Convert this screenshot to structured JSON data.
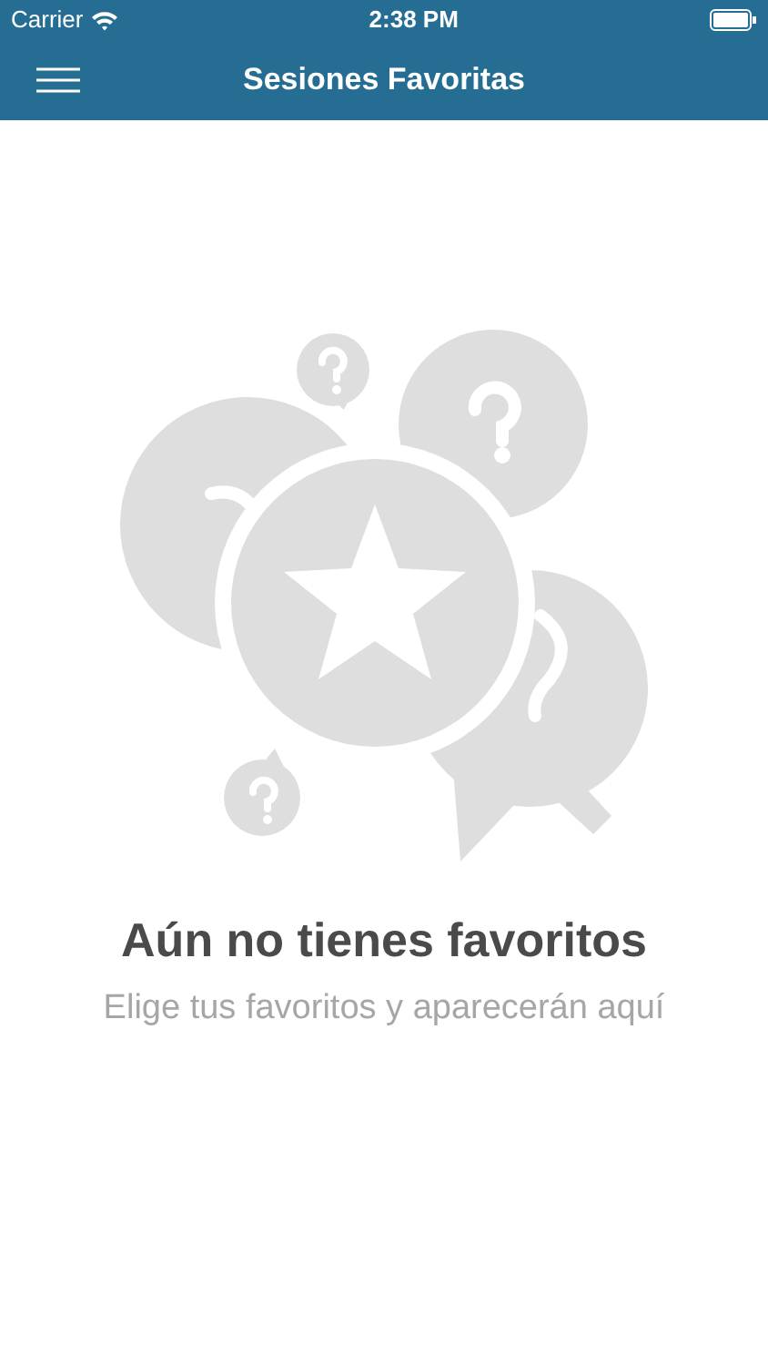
{
  "status_bar": {
    "carrier": "Carrier",
    "time": "2:38 PM"
  },
  "navbar": {
    "title": "Sesiones Favoritas"
  },
  "empty_state": {
    "title": "Aún no tienes favoritos",
    "message": "Elige tus favoritos y aparecerán aquí"
  }
}
